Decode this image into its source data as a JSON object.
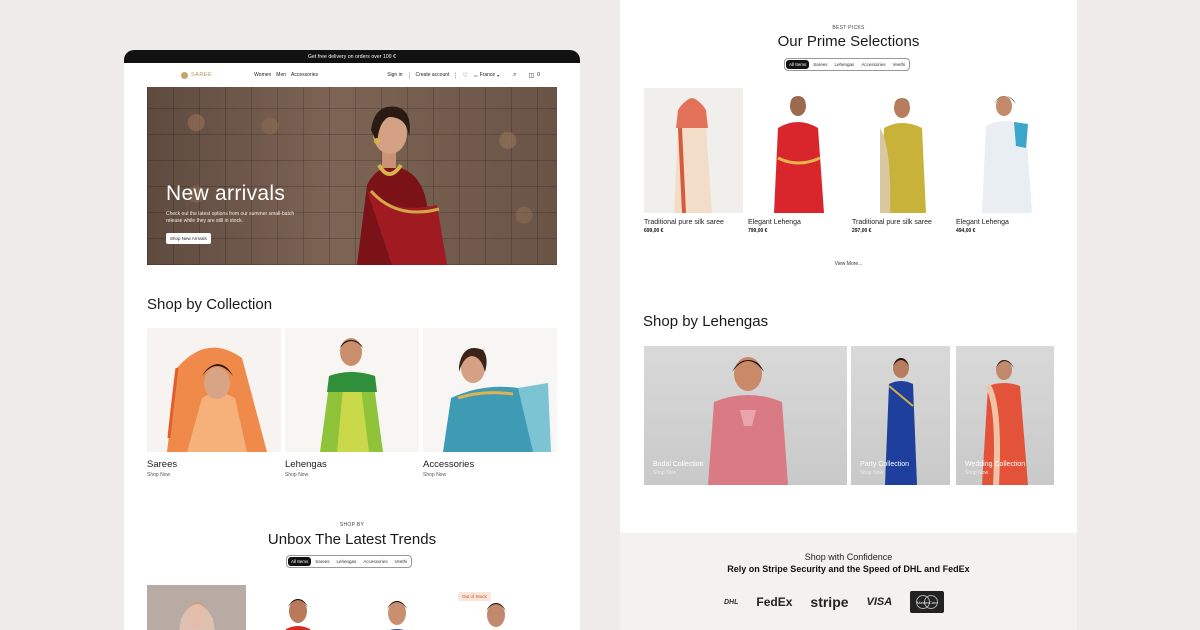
{
  "left_page": {
    "announcement": "Get free delivery on orders over 100 €",
    "brand": "SAREE",
    "nav_links": [
      "Women",
      "Men",
      "Accessories"
    ],
    "sign_in": "Sign in",
    "create_account": "Create account",
    "country": "France",
    "cart_count": "0",
    "hero": {
      "title": "New arrivals",
      "subtitle": "Check out the latest options from our summer small-batch release while they are still in stock.",
      "button": "Shop New Arrivals"
    },
    "collection_title": "Shop by Collection",
    "collections": [
      {
        "name": "Sarees",
        "link": "Shop Now"
      },
      {
        "name": "Lehengas",
        "link": "Shop Now"
      },
      {
        "name": "Accessories",
        "link": "Shop Now"
      }
    ],
    "trends_overline": "SHOP BY",
    "trends_title": "Unbox The Latest Trends",
    "tabs": [
      "All Items",
      "Sarees",
      "Lehengas",
      "Accessories",
      "Veethi"
    ],
    "out_of_stock": "Out of Stock"
  },
  "right_page": {
    "overline": "BEST PICKS",
    "title": "Our Prime Selections",
    "tabs": [
      "All Items",
      "Sarees",
      "Lehengas",
      "Accessories",
      "Veethi"
    ],
    "products": [
      {
        "name": "Traditional pure silk saree",
        "price": "699,00 €"
      },
      {
        "name": "Elegant Lehenga",
        "price": "799,00 €"
      },
      {
        "name": "Traditional pure silk saree",
        "price": "297,00 €"
      },
      {
        "name": "Elegant Lehenga",
        "price": "494,00 €"
      }
    ],
    "view_more": "View More...",
    "lehengas_title": "Shop by Lehengas",
    "lehengas": [
      {
        "name": "Bridal Collection",
        "link": "Shop Now"
      },
      {
        "name": "Party Collection",
        "link": "Shop Now"
      },
      {
        "name": "Wedding Collection",
        "link": "Shop Now"
      }
    ],
    "confidence_line1": "Shop with Confidence",
    "confidence_line2": "Rely on Stripe Security and the Speed of DHL and FedEx",
    "payment_logos": [
      "DHL",
      "FedEx",
      "stripe",
      "VISA",
      "MasterCard"
    ]
  },
  "colors": {
    "background": "#eeebe9",
    "accent_gold": "#c9a46a",
    "dark": "#111111",
    "out_of_stock": "#c0502a"
  }
}
